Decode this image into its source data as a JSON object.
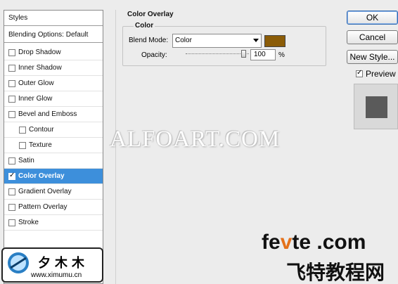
{
  "styles_panel": {
    "header": "Styles",
    "blending_options": "Blending Options: Default",
    "items": [
      {
        "label": "Drop Shadow",
        "checked": false,
        "selected": false
      },
      {
        "label": "Inner Shadow",
        "checked": false,
        "selected": false
      },
      {
        "label": "Outer Glow",
        "checked": false,
        "selected": false
      },
      {
        "label": "Inner Glow",
        "checked": false,
        "selected": false
      },
      {
        "label": "Bevel and Emboss",
        "checked": false,
        "selected": false
      },
      {
        "label": "Contour",
        "checked": false,
        "selected": false
      },
      {
        "label": "Texture",
        "checked": false,
        "selected": false
      },
      {
        "label": "Satin",
        "checked": false,
        "selected": false
      },
      {
        "label": "Color Overlay",
        "checked": true,
        "selected": true
      },
      {
        "label": "Gradient Overlay",
        "checked": false,
        "selected": false
      },
      {
        "label": "Pattern Overlay",
        "checked": false,
        "selected": false
      },
      {
        "label": "Stroke",
        "checked": false,
        "selected": false
      }
    ]
  },
  "color_overlay": {
    "title": "Color Overlay",
    "group_title": "Color",
    "blend_mode_label": "Blend Mode:",
    "blend_mode_value": "Color",
    "overlay_color": "#8b5c07",
    "opacity_label": "Opacity:",
    "opacity_value": "100",
    "opacity_unit": "%"
  },
  "buttons": {
    "ok": "OK",
    "cancel": "Cancel",
    "new_style": "New Style..."
  },
  "preview": {
    "label": "Preview",
    "checked": true
  },
  "watermarks": {
    "alfoart": "ALFOART.COM",
    "logo_cn": "夕木木",
    "logo_url": "www.ximumu.cn",
    "fevte_part1": "fe",
    "fevte_v": "v",
    "fevte_part2": "te .com",
    "fevte_cn": "飞特教程网"
  }
}
